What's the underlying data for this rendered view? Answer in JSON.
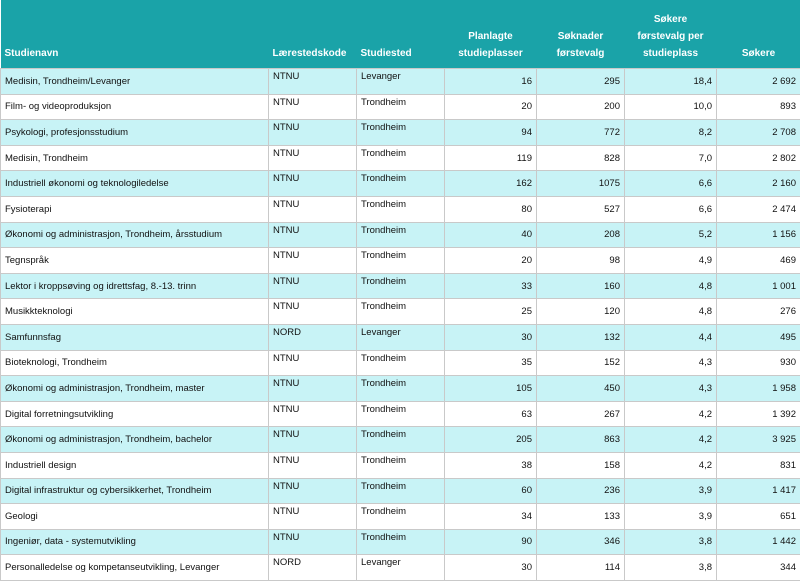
{
  "headers": {
    "studienavn": "Studienavn",
    "laerestedskode": "Lærestedskode",
    "studiested": "Studiested",
    "planlagte": [
      "Planlagte",
      "studieplasser"
    ],
    "soknader": [
      "Søknader",
      "førstevalg"
    ],
    "sokere_per": [
      "Søkere",
      "førstevalg per",
      "studieplass"
    ],
    "sokere": "Søkere"
  },
  "rows": [
    {
      "navn": "Medisin, Trondheim/Levanger",
      "kode": "NTNU",
      "sted": "Levanger",
      "plasser": "16",
      "soknader": "295",
      "per_plass": "18,4",
      "sokere": "2 692"
    },
    {
      "navn": "Film- og videoproduksjon",
      "kode": "NTNU",
      "sted": "Trondheim",
      "plasser": "20",
      "soknader": "200",
      "per_plass": "10,0",
      "sokere": "893"
    },
    {
      "navn": "Psykologi, profesjonsstudium",
      "kode": "NTNU",
      "sted": "Trondheim",
      "plasser": "94",
      "soknader": "772",
      "per_plass": "8,2",
      "sokere": "2 708"
    },
    {
      "navn": "Medisin, Trondheim",
      "kode": "NTNU",
      "sted": "Trondheim",
      "plasser": "119",
      "soknader": "828",
      "per_plass": "7,0",
      "sokere": "2 802"
    },
    {
      "navn": "Industriell økonomi og teknologiledelse",
      "kode": "NTNU",
      "sted": "Trondheim",
      "plasser": "162",
      "soknader": "1075",
      "per_plass": "6,6",
      "sokere": "2 160"
    },
    {
      "navn": "Fysioterapi",
      "kode": "NTNU",
      "sted": "Trondheim",
      "plasser": "80",
      "soknader": "527",
      "per_plass": "6,6",
      "sokere": "2 474"
    },
    {
      "navn": "Økonomi og administrasjon, Trondheim, årsstudium",
      "kode": "NTNU",
      "sted": "Trondheim",
      "plasser": "40",
      "soknader": "208",
      "per_plass": "5,2",
      "sokere": "1 156"
    },
    {
      "navn": "Tegnspråk",
      "kode": "NTNU",
      "sted": "Trondheim",
      "plasser": "20",
      "soknader": "98",
      "per_plass": "4,9",
      "sokere": "469"
    },
    {
      "navn": "Lektor i kroppsøving og idrettsfag, 8.-13. trinn",
      "kode": "NTNU",
      "sted": "Trondheim",
      "plasser": "33",
      "soknader": "160",
      "per_plass": "4,8",
      "sokere": "1 001"
    },
    {
      "navn": "Musikkteknologi",
      "kode": "NTNU",
      "sted": "Trondheim",
      "plasser": "25",
      "soknader": "120",
      "per_plass": "4,8",
      "sokere": "276"
    },
    {
      "navn": "Samfunnsfag",
      "kode": "NORD",
      "sted": "Levanger",
      "plasser": "30",
      "soknader": "132",
      "per_plass": "4,4",
      "sokere": "495"
    },
    {
      "navn": "Bioteknologi, Trondheim",
      "kode": "NTNU",
      "sted": "Trondheim",
      "plasser": "35",
      "soknader": "152",
      "per_plass": "4,3",
      "sokere": "930"
    },
    {
      "navn": "Økonomi og administrasjon, Trondheim, master",
      "kode": "NTNU",
      "sted": "Trondheim",
      "plasser": "105",
      "soknader": "450",
      "per_plass": "4,3",
      "sokere": "1 958"
    },
    {
      "navn": "Digital forretningsutvikling",
      "kode": "NTNU",
      "sted": "Trondheim",
      "plasser": "63",
      "soknader": "267",
      "per_plass": "4,2",
      "sokere": "1 392"
    },
    {
      "navn": "Økonomi og administrasjon, Trondheim, bachelor",
      "kode": "NTNU",
      "sted": "Trondheim",
      "plasser": "205",
      "soknader": "863",
      "per_plass": "4,2",
      "sokere": "3 925"
    },
    {
      "navn": "Industriell design",
      "kode": "NTNU",
      "sted": "Trondheim",
      "plasser": "38",
      "soknader": "158",
      "per_plass": "4,2",
      "sokere": "831"
    },
    {
      "navn": "Digital infrastruktur og cybersikkerhet, Trondheim",
      "kode": "NTNU",
      "sted": "Trondheim",
      "plasser": "60",
      "soknader": "236",
      "per_plass": "3,9",
      "sokere": "1 417"
    },
    {
      "navn": "Geologi",
      "kode": "NTNU",
      "sted": "Trondheim",
      "plasser": "34",
      "soknader": "133",
      "per_plass": "3,9",
      "sokere": "651"
    },
    {
      "navn": "Ingeniør, data - systemutvikling",
      "kode": "NTNU",
      "sted": "Trondheim",
      "plasser": "90",
      "soknader": "346",
      "per_plass": "3,8",
      "sokere": "1 442"
    },
    {
      "navn": "Personalledelse og kompetanseutvikling, Levanger",
      "kode": "NORD",
      "sted": "Levanger",
      "plasser": "30",
      "soknader": "114",
      "per_plass": "3,8",
      "sokere": "344"
    }
  ]
}
